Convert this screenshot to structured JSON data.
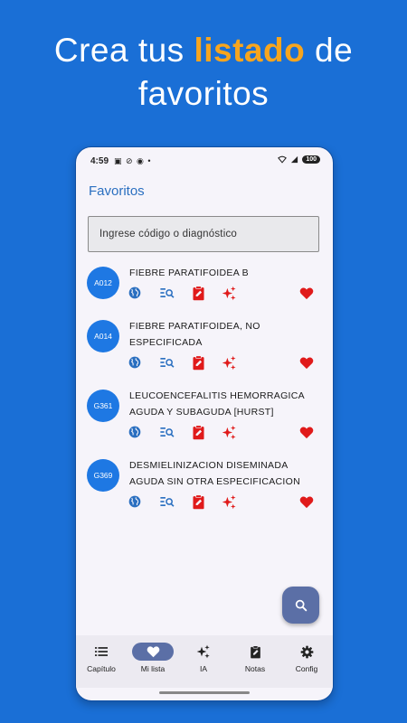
{
  "headline": {
    "part1": "Crea tus ",
    "highlight": "listado",
    "part2": " de",
    "line2": "favoritos"
  },
  "status_bar": {
    "time": "4:59",
    "icons": "▣ ⊘ ◉ •",
    "battery": "100"
  },
  "app": {
    "title": "Favoritos",
    "search_placeholder": "Ingrese código o diagnóstico"
  },
  "favorites": [
    {
      "code": "A012",
      "line1": "FIEBRE PARATIFOIDEA B",
      "line2": ""
    },
    {
      "code": "A014",
      "line1": "FIEBRE PARATIFOIDEA, NO",
      "line2": "ESPECIFICADA"
    },
    {
      "code": "G361",
      "line1": "LEUCOENCEFALITIS HEMORRAGICA",
      "line2": "AGUDA Y SUBAGUDA [HURST]"
    },
    {
      "code": "G369",
      "line1": "DESMIELINIZACION DISEMINADA",
      "line2": "AGUDA SIN OTRA ESPECIFICACION"
    }
  ],
  "item_actions": [
    "globe-icon",
    "search-list-icon",
    "clipboard-edit-icon",
    "sparkle-icon",
    "heart-icon"
  ],
  "bottom_nav": [
    {
      "label": "Capítulo",
      "icon": "list-icon"
    },
    {
      "label": "Mi lista",
      "icon": "heart-icon"
    },
    {
      "label": "IA",
      "icon": "sparkle-icon"
    },
    {
      "label": "Notas",
      "icon": "clipboard-edit-icon"
    },
    {
      "label": "Config",
      "icon": "gear-icon"
    }
  ],
  "colors": {
    "background": "#1a6fd6",
    "highlight": "#f7a51e",
    "code_badge": "#1e78e3",
    "action_blue": "#2a6fc0",
    "action_red": "#e01a1a",
    "fab": "#5b6fa6"
  }
}
